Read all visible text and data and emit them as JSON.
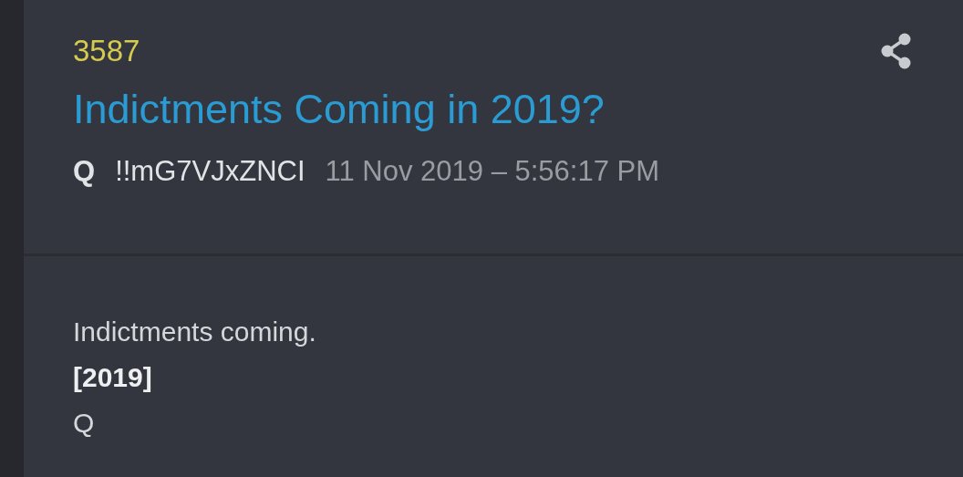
{
  "post": {
    "number": "3587",
    "title": "Indictments Coming in 2019?",
    "author": "Q",
    "tripcode": "!!mG7VJxZNCI",
    "timestamp": "11 Nov 2019 – 5:56:17 PM"
  },
  "body": [
    {
      "text": "Indictments coming.",
      "kind": "plain"
    },
    {
      "text": "[2019]",
      "kind": "bold"
    },
    {
      "text": "Q",
      "kind": "plain"
    }
  ]
}
